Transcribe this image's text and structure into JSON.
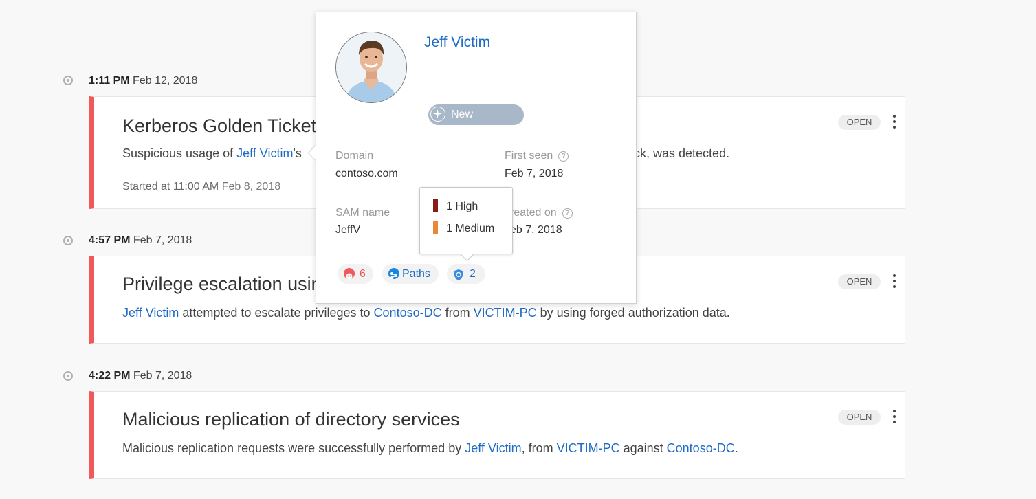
{
  "timeline": [
    {
      "time": "1:11 PM",
      "date": "Feb 12, 2018",
      "title": "Kerberos Golden Ticket",
      "desc_pre": "Suspicious usage of ",
      "desc_link1": "Jeff Victim",
      "desc_mid": "'s",
      "desc_post": "ack, was detected.",
      "meta_label": "Started at 11:00 AM ",
      "meta_date": "Feb 8, 2018",
      "status": "OPEN"
    },
    {
      "time": "4:57 PM",
      "date": "Feb 7, 2018",
      "title": "Privilege escalation usin",
      "desc_link1": "Jeff Victim",
      "desc_a": " attempted to escalate privileges to ",
      "desc_link2": "Contoso-DC",
      "desc_b": " from ",
      "desc_link3": "VICTIM-PC",
      "desc_c": " by using forged authorization data.",
      "status": "OPEN"
    },
    {
      "time": "4:22 PM",
      "date": "Feb 7, 2018",
      "title": "Malicious replication of directory services",
      "desc_a": "Malicious replication requests were successfully performed by ",
      "desc_link1": "Jeff Victim",
      "desc_b": ", from ",
      "desc_link2": "VICTIM-PC",
      "desc_c": " against ",
      "desc_link3": "Contoso-DC",
      "desc_d": ".",
      "status": "OPEN"
    }
  ],
  "popover": {
    "name": "Jeff Victim",
    "tag": "New",
    "domain_label": "Domain",
    "domain_value": "contoso.com",
    "first_seen_label": "First seen",
    "first_seen_value": "Feb 7, 2018",
    "sam_label": "SAM name",
    "sam_value": "JeffV",
    "created_label": "reated on",
    "created_value": "eb 7, 2018",
    "help_glyph": "?",
    "chips": {
      "alerts_count": "6",
      "paths_label": "Paths",
      "shield_count": "2"
    }
  },
  "tooltip": {
    "high": "1  High",
    "medium": "1  Medium",
    "high_color": "#8b1a1a",
    "medium_color": "#e8893a"
  },
  "colors": {
    "accent": "#1e6bc4",
    "alert_red": "#f0585a"
  }
}
